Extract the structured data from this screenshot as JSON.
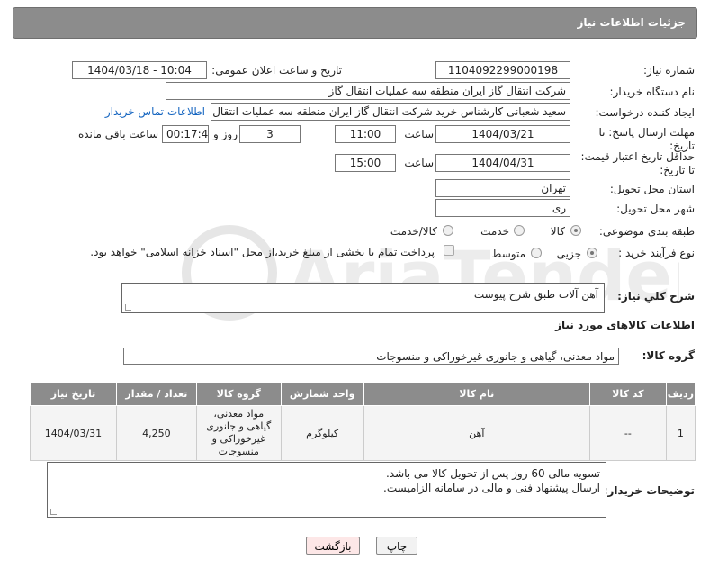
{
  "header": {
    "title": "جزئیات اطلاعات نیاز"
  },
  "form": {
    "need_number_label": "شماره نیاز:",
    "need_number": "1104092299000198",
    "announce_label": "تاریخ و ساعت اعلان عمومی:",
    "announce_value": "1404/03/18 - 10:04",
    "buyer_org_label": "نام دستگاه خریدار:",
    "buyer_org": "شرکت انتقال گاز ایران منطقه سه عملیات انتقال گاز",
    "requester_label": "ایجاد کننده درخواست:",
    "requester": "سعید شعبانی کارشناس خرید شرکت انتقال گاز ایران منطقه سه عملیات انتقال گاز",
    "contact_link": "اطلاعات تماس خریدار",
    "deadline_label": "مهلت ارسال پاسخ: تا تاریخ:",
    "deadline_date": "1404/03/21",
    "time_label": "ساعت",
    "deadline_time": "11:00",
    "days": "3",
    "days_label": "روز و",
    "remaining": "00:17:40",
    "remaining_label": "ساعت باقی مانده",
    "min_price_label": "حداقل تاریخ اعتبار قیمت: تا تاریخ:",
    "min_price_date": "1404/04/31",
    "min_price_time": "15:00",
    "province_label": "استان محل تحویل:",
    "province": "تهران",
    "city_label": "شهر محل تحویل:",
    "city": "ری",
    "category_label": "طبقه بندی موضوعی:",
    "category_options": [
      "کالا",
      "خدمت",
      "کالا/خدمت"
    ],
    "category_selected": "کالا",
    "process_label": "نوع فرآیند خرید :",
    "process_options": [
      "جزیی",
      "متوسط"
    ],
    "process_selected": "جزیی",
    "payment_note": "پرداخت تمام یا بخشی از مبلغ خرید،از محل \"اسناد خزانه اسلامی\" خواهد بود."
  },
  "summary": {
    "label": "شرح کلي نياز:",
    "value": "آهن آلات طبق شرح پیوست"
  },
  "goods": {
    "section_title": "اطلاعات کالاهای مورد نیاز",
    "group_label": "گروه کالا:",
    "group_value": "مواد معدنی، گیاهی و جانوری غیرخوراکی و منسوجات",
    "columns": [
      "ردیف",
      "کد کالا",
      "نام کالا",
      "واحد شمارش",
      "گروه کالا",
      "تعداد / مقدار",
      "تاریخ نیاز"
    ],
    "rows": [
      {
        "row": "1",
        "code": "--",
        "name": "آهن",
        "unit": "کیلوگرم",
        "group": "مواد معدنی، گیاهی و جانوری غیرخوراکی و منسوجات",
        "qty": "4,250",
        "date": "1404/03/31"
      }
    ]
  },
  "buyer_notes": {
    "label": "توضیحات خریدار:",
    "line1": "تسویه مالی 60 روز پس از تحویل کالا می باشد.",
    "line2": "ارسال پیشنهاد فنی و مالی در سامانه الزامیست."
  },
  "buttons": {
    "print": "چاپ",
    "back": "بازگشت"
  },
  "colors": {
    "header_bg": "#8c8c8c",
    "link": "#1565c0",
    "back_btn_bg": "#fde7e7"
  }
}
